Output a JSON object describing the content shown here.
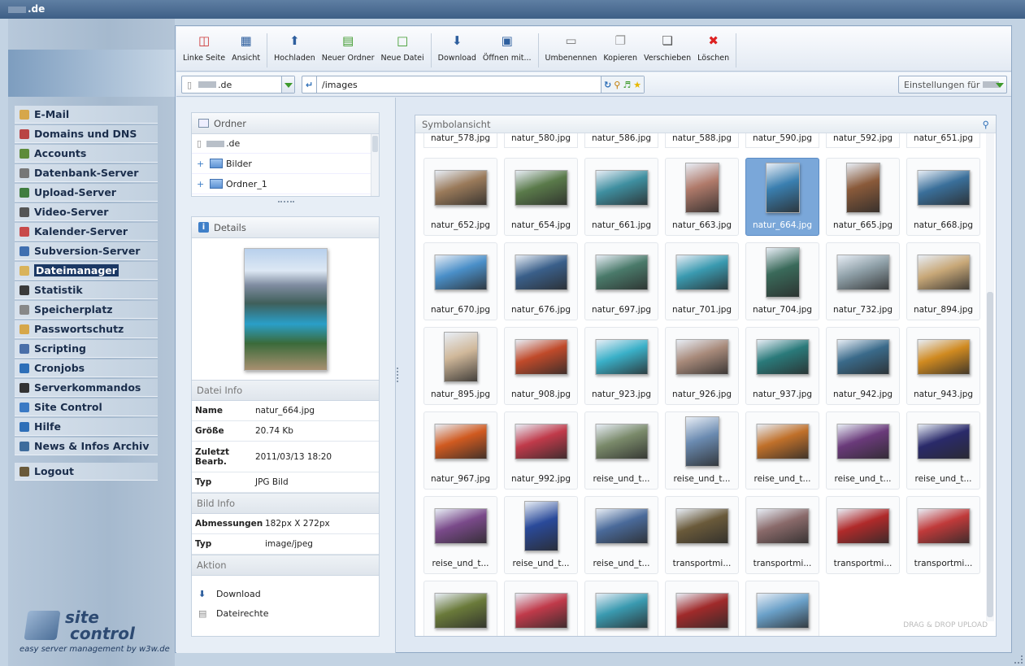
{
  "topbar": {
    "title": ".de"
  },
  "nav": [
    {
      "label": "E-Mail",
      "color": "#d6a74a"
    },
    {
      "label": "Domains und DNS",
      "color": "#b94444"
    },
    {
      "label": "Accounts",
      "color": "#5d8b3a"
    },
    {
      "label": "Datenbank-Server",
      "color": "#777777"
    },
    {
      "label": "Upload-Server",
      "color": "#3f7d3f"
    },
    {
      "label": "Video-Server",
      "color": "#555555"
    },
    {
      "label": "Kalender-Server",
      "color": "#c84a4a"
    },
    {
      "label": "Subversion-Server",
      "color": "#3f6fb0"
    },
    {
      "label": "Dateimanager",
      "color": "#d9b35a",
      "active": true
    },
    {
      "label": "Statistik",
      "color": "#3a3a3a"
    },
    {
      "label": "Speicherplatz",
      "color": "#888888"
    },
    {
      "label": "Passwortschutz",
      "color": "#d6a74a"
    },
    {
      "label": "Scripting",
      "color": "#4a6fa8"
    },
    {
      "label": "Cronjobs",
      "color": "#2e6fb8"
    },
    {
      "label": "Serverkommandos",
      "color": "#333333"
    },
    {
      "label": "Site Control",
      "color": "#3a79c4"
    },
    {
      "label": "Hilfe",
      "color": "#2e6fb8"
    },
    {
      "label": "News & Infos Archiv",
      "color": "#3e6c9c"
    }
  ],
  "logout": "Logout",
  "logo": {
    "word1": "site",
    "word2": "control",
    "tagline": "easy server management by w3w.de"
  },
  "toolbar": [
    [
      {
        "label": "Linke Seite",
        "icon": "split-view-icon"
      },
      {
        "label": "Ansicht",
        "icon": "grid-view-icon"
      }
    ],
    [
      {
        "label": "Hochladen",
        "icon": "upload-icon"
      },
      {
        "label": "Neuer Ordner",
        "icon": "new-folder-icon"
      },
      {
        "label": "Neue Datei",
        "icon": "new-file-icon"
      }
    ],
    [
      {
        "label": "Download",
        "icon": "download-icon"
      },
      {
        "label": "Öffnen mit...",
        "icon": "open-with-icon"
      }
    ],
    [
      {
        "label": "Umbenennen",
        "icon": "rename-icon"
      },
      {
        "label": "Kopieren",
        "icon": "copy-icon"
      },
      {
        "label": "Verschieben",
        "icon": "move-icon"
      },
      {
        "label": "Löschen",
        "icon": "delete-icon"
      }
    ]
  ],
  "path": {
    "server": ".de",
    "path": "/images",
    "settings": "Einstellungen für"
  },
  "folders": {
    "title": "Ordner",
    "root": ".de",
    "items": [
      "Bilder",
      "Ordner_1"
    ]
  },
  "details": {
    "title": "Details",
    "datei_info": "Datei Info",
    "rows": [
      {
        "k": "Name",
        "v": "natur_664.jpg"
      },
      {
        "k": "Größe",
        "v": "20.74 Kb"
      },
      {
        "k": "Zuletzt Bearb.",
        "v": "2011/03/13 18:20"
      },
      {
        "k": "Typ",
        "v": "JPG Bild"
      }
    ],
    "bild_info": "Bild Info",
    "bild_rows": [
      {
        "k": "Abmessungen",
        "v": "182px X 272px"
      },
      {
        "k": "Typ",
        "v": "image/jpeg"
      }
    ],
    "aktion": "Aktion",
    "actions": [
      "Download",
      "Dateirechte"
    ]
  },
  "view": {
    "title": "Symbolansicht",
    "drop": "DRAG & DROP UPLOAD"
  },
  "top_row": [
    "natur_578.jpg",
    "natur_580.jpg",
    "natur_586.jpg",
    "natur_588.jpg",
    "natur_590.jpg",
    "natur_592.jpg",
    "natur_651.jpg"
  ],
  "files": [
    {
      "name": "natur_652.jpg",
      "c": "#9a7a5a",
      "p": 0
    },
    {
      "name": "natur_654.jpg",
      "c": "#5a7a4a",
      "p": 0
    },
    {
      "name": "natur_661.jpg",
      "c": "#3f8fa0",
      "p": 0
    },
    {
      "name": "natur_663.jpg",
      "c": "#b07a6a",
      "p": 1
    },
    {
      "name": "natur_664.jpg",
      "c": "#3a7fb0",
      "p": 1,
      "sel": true
    },
    {
      "name": "natur_665.jpg",
      "c": "#8a5a3a",
      "p": 1
    },
    {
      "name": "natur_668.jpg",
      "c": "#3a6f9a",
      "p": 0
    },
    {
      "name": "natur_670.jpg",
      "c": "#4a8fc8",
      "p": 0
    },
    {
      "name": "natur_676.jpg",
      "c": "#3a5f8a",
      "p": 0
    },
    {
      "name": "natur_697.jpg",
      "c": "#4a7a6a",
      "p": 0
    },
    {
      "name": "natur_701.jpg",
      "c": "#3a9ab0",
      "p": 0
    },
    {
      "name": "natur_704.jpg",
      "c": "#3a6a5a",
      "p": 1
    },
    {
      "name": "natur_732.jpg",
      "c": "#8fa0a8",
      "p": 0
    },
    {
      "name": "natur_894.jpg",
      "c": "#c8a878",
      "p": 0
    },
    {
      "name": "natur_895.jpg",
      "c": "#d0b89a",
      "p": 1
    },
    {
      "name": "natur_908.jpg",
      "c": "#c04a2a",
      "p": 0
    },
    {
      "name": "natur_923.jpg",
      "c": "#3ab0c8",
      "p": 0
    },
    {
      "name": "natur_926.jpg",
      "c": "#a88a7a",
      "p": 0
    },
    {
      "name": "natur_937.jpg",
      "c": "#2a7a7a",
      "p": 0
    },
    {
      "name": "natur_942.jpg",
      "c": "#3a6a8a",
      "p": 0
    },
    {
      "name": "natur_943.jpg",
      "c": "#d08a20",
      "p": 0
    },
    {
      "name": "natur_967.jpg",
      "c": "#d05a20",
      "p": 0
    },
    {
      "name": "natur_992.jpg",
      "c": "#c03a4a",
      "p": 0
    },
    {
      "name": "reise_und_t...",
      "c": "#7a8a6a",
      "p": 0
    },
    {
      "name": "reise_und_t...",
      "c": "#6a8ab0",
      "p": 1
    },
    {
      "name": "reise_und_t...",
      "c": "#c0702a",
      "p": 0
    },
    {
      "name": "reise_und_t...",
      "c": "#6a3a7a",
      "p": 0
    },
    {
      "name": "reise_und_t...",
      "c": "#2a2a6a",
      "p": 0
    },
    {
      "name": "reise_und_t...",
      "c": "#7a4a8a",
      "p": 0
    },
    {
      "name": "reise_und_t...",
      "c": "#2a4a9a",
      "p": 1
    },
    {
      "name": "reise_und_t...",
      "c": "#4a6a9a",
      "p": 0
    },
    {
      "name": "transportmi...",
      "c": "#6a5a3a",
      "p": 0
    },
    {
      "name": "transportmi...",
      "c": "#8a6a6a",
      "p": 0
    },
    {
      "name": "transportmi...",
      "c": "#b02a2a",
      "p": 0
    },
    {
      "name": "transportmi...",
      "c": "#c03a3a",
      "p": 0
    },
    {
      "name": "",
      "c": "#6a7a3a",
      "p": 0
    },
    {
      "name": "",
      "c": "#c03a4a",
      "p": 0
    },
    {
      "name": "",
      "c": "#3a9ab0",
      "p": 0
    },
    {
      "name": "",
      "c": "#a02a2a",
      "p": 0
    },
    {
      "name": "",
      "c": "#6aa0c8",
      "p": 0
    }
  ]
}
